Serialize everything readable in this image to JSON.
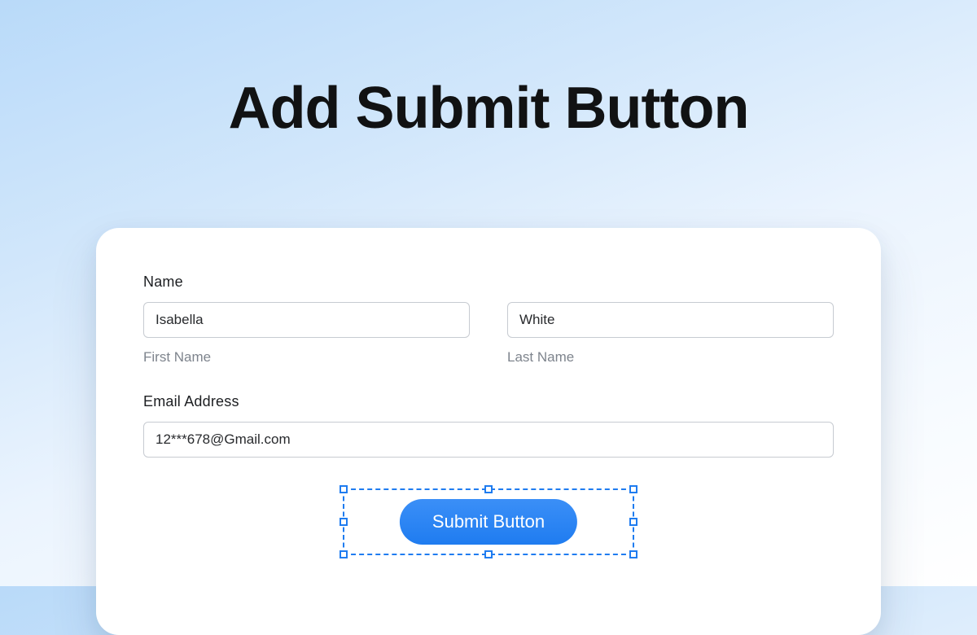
{
  "title": "Add Submit Button",
  "form": {
    "name_label": "Name",
    "first_name": {
      "value": "Isabella",
      "sublabel": "First Name"
    },
    "last_name": {
      "value": "White",
      "sublabel": "Last Name"
    },
    "email": {
      "label": "Email  Address",
      "value": "12***678@Gmail.com"
    },
    "submit_label": "Submit Button"
  }
}
